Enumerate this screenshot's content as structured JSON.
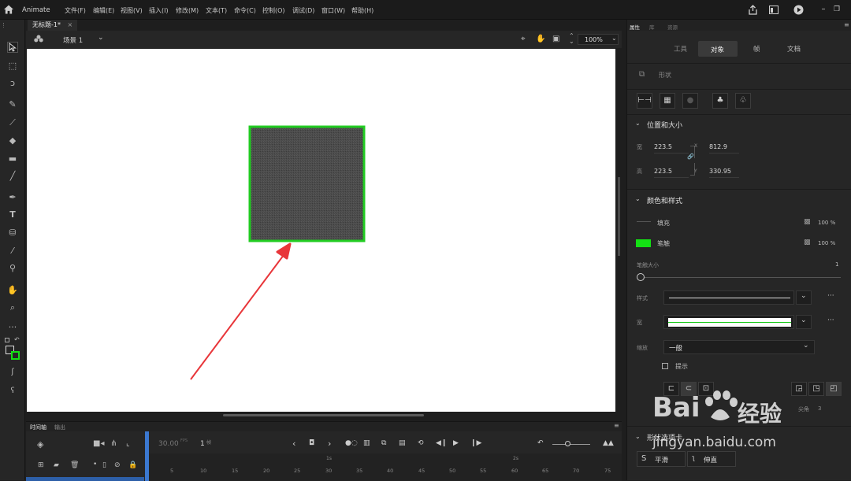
{
  "app": {
    "name": "Animate",
    "menus": [
      "文件(F)",
      "编辑(E)",
      "视图(V)",
      "插入(I)",
      "修改(M)",
      "文本(T)",
      "命令(C)",
      "控制(O)",
      "调试(D)",
      "窗口(W)",
      "帮助(H)"
    ]
  },
  "document": {
    "tab_title": "无标题-1*",
    "tab_close": "×",
    "scene_label": "场景 1",
    "zoom": "100%"
  },
  "stage": {
    "shape_fill_color": "#4a4a4a",
    "shape_stroke_color": "#22cc22",
    "arrow_color": "#e8363a"
  },
  "timeline": {
    "tabs": [
      "时间轴",
      "输出"
    ],
    "fps": "30.00",
    "fps_unit": "FPS",
    "frame": "1",
    "frame_unit": "帧",
    "seconds_markers": [
      "1s",
      "2s"
    ],
    "frame_ticks": [
      "5",
      "10",
      "15",
      "20",
      "25",
      "30",
      "35",
      "40",
      "45",
      "50",
      "55",
      "60",
      "65",
      "70",
      "75"
    ]
  },
  "properties": {
    "panel_tabs": [
      "属性",
      "库",
      "资源"
    ],
    "subtabs": [
      "工具",
      "对象",
      "帧",
      "文档"
    ],
    "object_type": "形状",
    "position_size": {
      "title": "位置和大小",
      "width_label": "宽",
      "width": "223.5",
      "height_label": "高",
      "height": "223.5",
      "x_label": "X",
      "x": "812.9",
      "y_label": "Y",
      "y": "330.95"
    },
    "color_style": {
      "title": "颜色和样式",
      "fill_label": "填充",
      "fill_alpha": "100 %",
      "stroke_label": "笔触",
      "stroke_color": "#14e014",
      "stroke_alpha": "100 %",
      "stroke_size_label": "笔触大小",
      "stroke_size": "1",
      "style_label": "样式",
      "width_label": "宽",
      "scale_label": "缩放",
      "scale_value": "一般",
      "hint_label": "提示",
      "miter_label": "尖角",
      "miter_value": "3"
    },
    "shape_options": {
      "title": "形状选项卡",
      "smooth_label": "平滑",
      "straighten_label": "伸直"
    }
  },
  "watermark": {
    "brand": "Bai",
    "brand_suffix": "经验",
    "url": "jingyan.baidu.com"
  }
}
